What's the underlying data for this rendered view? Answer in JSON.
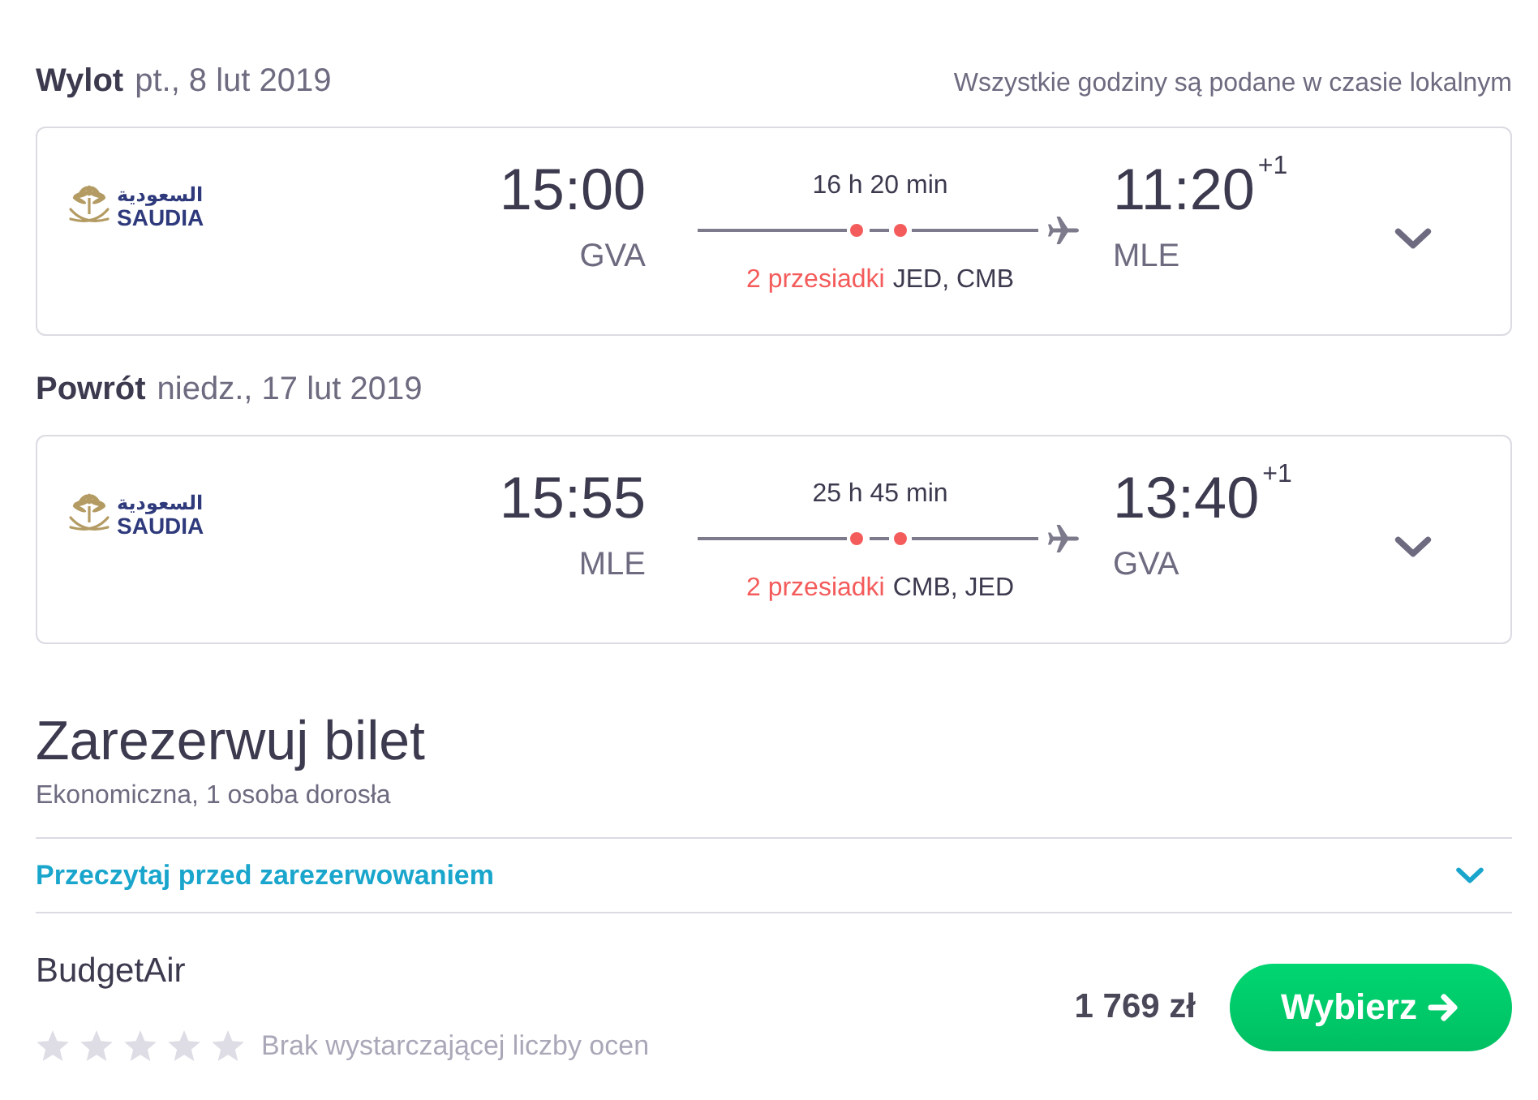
{
  "legs": [
    {
      "label": "Wylot",
      "date": "pt., 8 lut 2019",
      "note": "Wszystkie godziny są podane w czasie lokalnym",
      "airline": {
        "name_arabic": "السعودية",
        "name": "SAUDIA"
      },
      "departure": {
        "time": "15:00",
        "airport": "GVA"
      },
      "duration": "16 h 20 min",
      "stops": {
        "count_label": "2 przesiadki",
        "airports": "JED, CMB"
      },
      "arrival": {
        "time": "11:20",
        "day_offset": "+1",
        "airport": "MLE"
      },
      "expanded": false
    },
    {
      "label": "Powrót",
      "date": "niedz., 17 lut 2019",
      "airline": {
        "name_arabic": "السعودية",
        "name": "SAUDIA"
      },
      "departure": {
        "time": "15:55",
        "airport": "MLE"
      },
      "duration": "25 h 45 min",
      "stops": {
        "count_label": "2 przesiadki",
        "airports": "CMB, JED"
      },
      "arrival": {
        "time": "13:40",
        "day_offset": "+1",
        "airport": "GVA"
      },
      "expanded": false
    }
  ],
  "booking": {
    "title": "Zarezerwuj bilet",
    "subtitle": "Ekonomiczna, 1 osoba dorosła",
    "notice": {
      "label": "Przeczytaj przed zarezerwowaniem",
      "expanded": false
    },
    "offer": {
      "provider": "BudgetAir",
      "stars": 0,
      "rating_text": "Brak wystarczającej liczby ocen",
      "price": "1 769 zł",
      "button": "Wybierz"
    }
  }
}
